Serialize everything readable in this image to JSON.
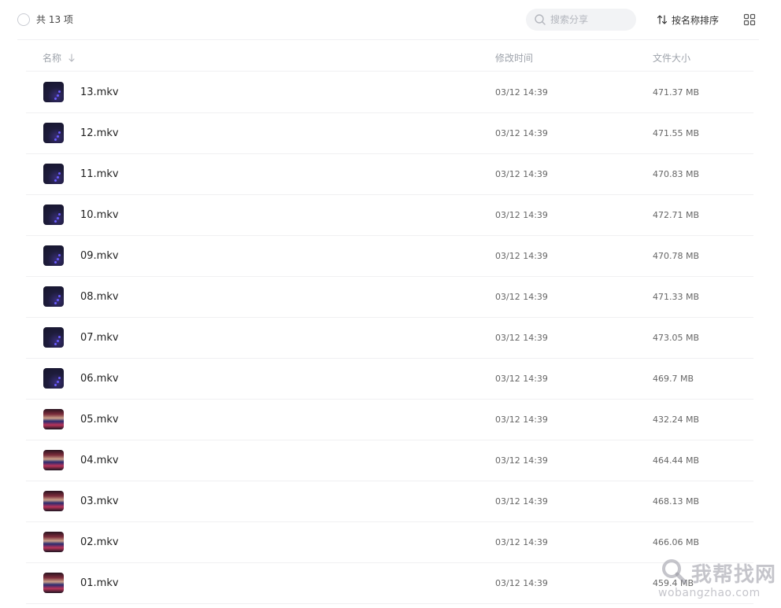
{
  "toolbar": {
    "total_label": "共 13 项",
    "search_placeholder": "搜索分享",
    "sort_label": "按名称排序"
  },
  "columns": {
    "name": "名称",
    "modified": "修改时间",
    "size": "文件大小"
  },
  "files": [
    {
      "name": "13.mkv",
      "modified": "03/12 14:39",
      "size": "471.37 MB",
      "thumb": "dark"
    },
    {
      "name": "12.mkv",
      "modified": "03/12 14:39",
      "size": "471.55 MB",
      "thumb": "dark"
    },
    {
      "name": "11.mkv",
      "modified": "03/12 14:39",
      "size": "470.83 MB",
      "thumb": "dark"
    },
    {
      "name": "10.mkv",
      "modified": "03/12 14:39",
      "size": "472.71 MB",
      "thumb": "dark"
    },
    {
      "name": "09.mkv",
      "modified": "03/12 14:39",
      "size": "470.78 MB",
      "thumb": "dark"
    },
    {
      "name": "08.mkv",
      "modified": "03/12 14:39",
      "size": "471.33 MB",
      "thumb": "dark"
    },
    {
      "name": "07.mkv",
      "modified": "03/12 14:39",
      "size": "473.05 MB",
      "thumb": "dark"
    },
    {
      "name": "06.mkv",
      "modified": "03/12 14:39",
      "size": "469.7 MB",
      "thumb": "dark"
    },
    {
      "name": "05.mkv",
      "modified": "03/12 14:39",
      "size": "432.24 MB",
      "thumb": "colorful"
    },
    {
      "name": "04.mkv",
      "modified": "03/12 14:39",
      "size": "464.44 MB",
      "thumb": "colorful"
    },
    {
      "name": "03.mkv",
      "modified": "03/12 14:39",
      "size": "468.13 MB",
      "thumb": "colorful"
    },
    {
      "name": "02.mkv",
      "modified": "03/12 14:39",
      "size": "466.06 MB",
      "thumb": "colorful"
    },
    {
      "name": "01.mkv",
      "modified": "03/12 14:39",
      "size": "459.4 MB",
      "thumb": "colorful"
    }
  ],
  "watermark": {
    "cn": "我帮找网",
    "en": "wobangzhao.com"
  },
  "icons": {
    "select_all": "circle-checkbox-icon",
    "search": "search-icon",
    "sort": "sort-arrows-icon",
    "view": "grid-view-icon",
    "sort_direction": "arrow-down-icon"
  },
  "colors": {
    "divider": "#f0f0f2",
    "header_text": "#9ea3ab",
    "search_bg": "#f2f3f5"
  }
}
